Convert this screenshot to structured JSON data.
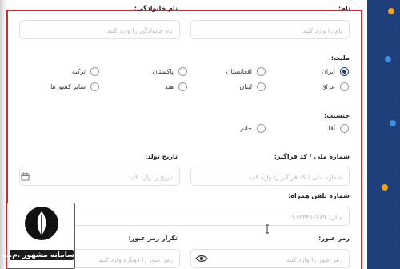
{
  "form": {
    "first_name": {
      "label": "نام:",
      "placeholder": "نام را وارد کنید"
    },
    "last_name": {
      "label": "نام خانوادگی:",
      "placeholder": "نام خانوادگی را وارد کنید"
    },
    "nationality": {
      "label": "ملیت:",
      "options": [
        "ایران",
        "افغانستان",
        "پاکستان",
        "ترکیه",
        "عراق",
        "لبنان",
        "هند",
        "سایر کشورها"
      ],
      "selected": "ایران"
    },
    "gender": {
      "label": "جنسیت:",
      "options": [
        "آقا",
        "خانم"
      ]
    },
    "national_id": {
      "label": "شماره ملی / کد فراگیر:",
      "placeholder": "شماره ملی / کد فراگیر را وارد کنید"
    },
    "birth_date": {
      "label": "تاریخ تولد:",
      "placeholder": "تاریخ را وارد کنید",
      "icon": "calendar-icon"
    },
    "mobile": {
      "label": "شماره تلفن همراه:",
      "placeholder": "مثال: ۰۹۱۲۳۴۵۶۷۸۹"
    },
    "password": {
      "label": "رمز عبور:",
      "placeholder": "رمز عبور را وارد کنید"
    },
    "password_confirm": {
      "label": "تکرار رمز عبور:",
      "placeholder": "رمز عبور را دوباره وارد کنید",
      "icon": "eye-icon"
    }
  },
  "logo": {
    "text": "سامانه مشهور .م.پ"
  },
  "colors": {
    "accent": "#1f3f7a",
    "highlight_frame": "#d8262c"
  }
}
